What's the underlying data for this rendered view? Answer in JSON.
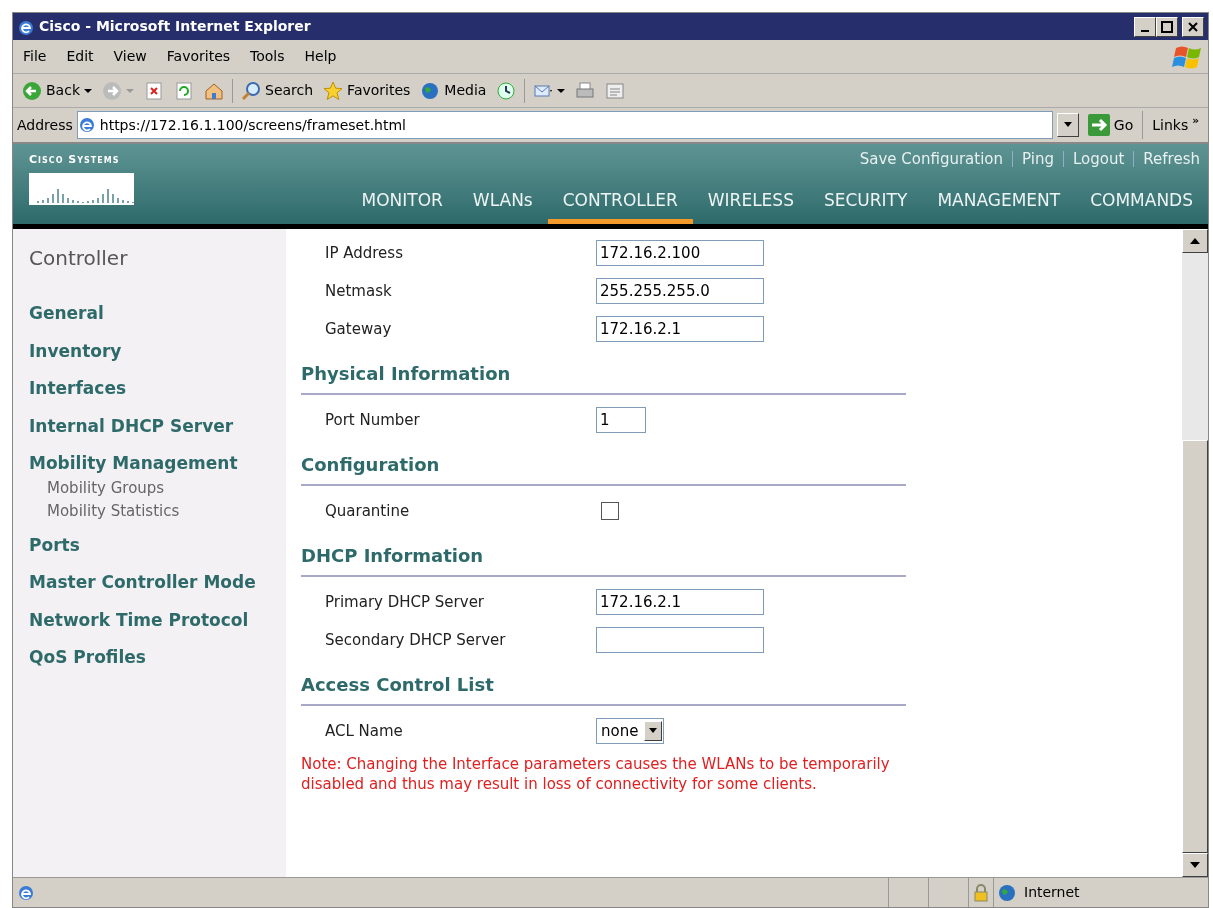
{
  "window": {
    "title": "Cisco - Microsoft Internet Explorer"
  },
  "menu": [
    "File",
    "Edit",
    "View",
    "Favorites",
    "Tools",
    "Help"
  ],
  "toolbar": [
    {
      "kind": "back",
      "label": "Back"
    },
    {
      "kind": "forward"
    },
    {
      "kind": "stop"
    },
    {
      "kind": "refresh"
    },
    {
      "kind": "home"
    },
    {
      "kind": "search",
      "label": "Search"
    },
    {
      "kind": "favorites",
      "label": "Favorites"
    },
    {
      "kind": "media",
      "label": "Media"
    },
    {
      "kind": "history"
    },
    {
      "kind": "mail"
    },
    {
      "kind": "print"
    },
    {
      "kind": "edit"
    }
  ],
  "address": {
    "label": "Address",
    "url": "https://172.16.1.100/screens/frameset.html",
    "go": "Go",
    "links": "Links",
    "more": "»"
  },
  "header": {
    "logo": "Cisco Systems",
    "top_links": [
      "Save Configuration",
      "Ping",
      "Logout",
      "Refresh"
    ],
    "tabs": [
      {
        "label": "MONITOR",
        "selected": false
      },
      {
        "label": "WLANs",
        "selected": false
      },
      {
        "label": "CONTROLLER",
        "selected": true
      },
      {
        "label": "WIRELESS",
        "selected": false
      },
      {
        "label": "SECURITY",
        "selected": false
      },
      {
        "label": "MANAGEMENT",
        "selected": false
      },
      {
        "label": "COMMANDS",
        "selected": false
      }
    ]
  },
  "sidebar": {
    "title": "Controller",
    "items": [
      {
        "label": "General"
      },
      {
        "label": "Inventory"
      },
      {
        "label": "Interfaces"
      },
      {
        "label": "Internal DHCP Server"
      },
      {
        "label": "Mobility Management",
        "children": [
          {
            "label": "Mobility Groups"
          },
          {
            "label": "Mobility Statistics"
          }
        ]
      },
      {
        "label": "Ports"
      },
      {
        "label": "Master Controller Mode"
      },
      {
        "label": "Network Time Protocol"
      },
      {
        "label": "QoS Profiles"
      }
    ]
  },
  "top_fields": [
    {
      "kind": "text",
      "label": "IP Address",
      "value": "172.16.2.100"
    },
    {
      "kind": "text",
      "label": "Netmask",
      "value": "255.255.255.0"
    },
    {
      "kind": "text",
      "label": "Gateway",
      "value": "172.16.2.1"
    }
  ],
  "sections": [
    {
      "title": "Physical Information",
      "fields": [
        {
          "kind": "short",
          "label": "Port Number",
          "value": "1"
        }
      ]
    },
    {
      "title": "Configuration",
      "fields": [
        {
          "kind": "checkbox",
          "label": "Quarantine",
          "checked": false
        }
      ]
    },
    {
      "title": "DHCP Information",
      "fields": [
        {
          "kind": "text",
          "label": "Primary DHCP Server",
          "value": "172.16.2.1"
        },
        {
          "kind": "text",
          "label": "Secondary DHCP Server"
        }
      ]
    },
    {
      "title": "Access Control List",
      "fields": [
        {
          "kind": "select",
          "label": "ACL Name",
          "value": "none"
        }
      ]
    }
  ],
  "note": "Note: Changing the Interface parameters causes the WLANs to be temporarily disabled and thus may result in loss of connectivity for some clients.",
  "status_bar": {
    "zone": "Internet"
  }
}
